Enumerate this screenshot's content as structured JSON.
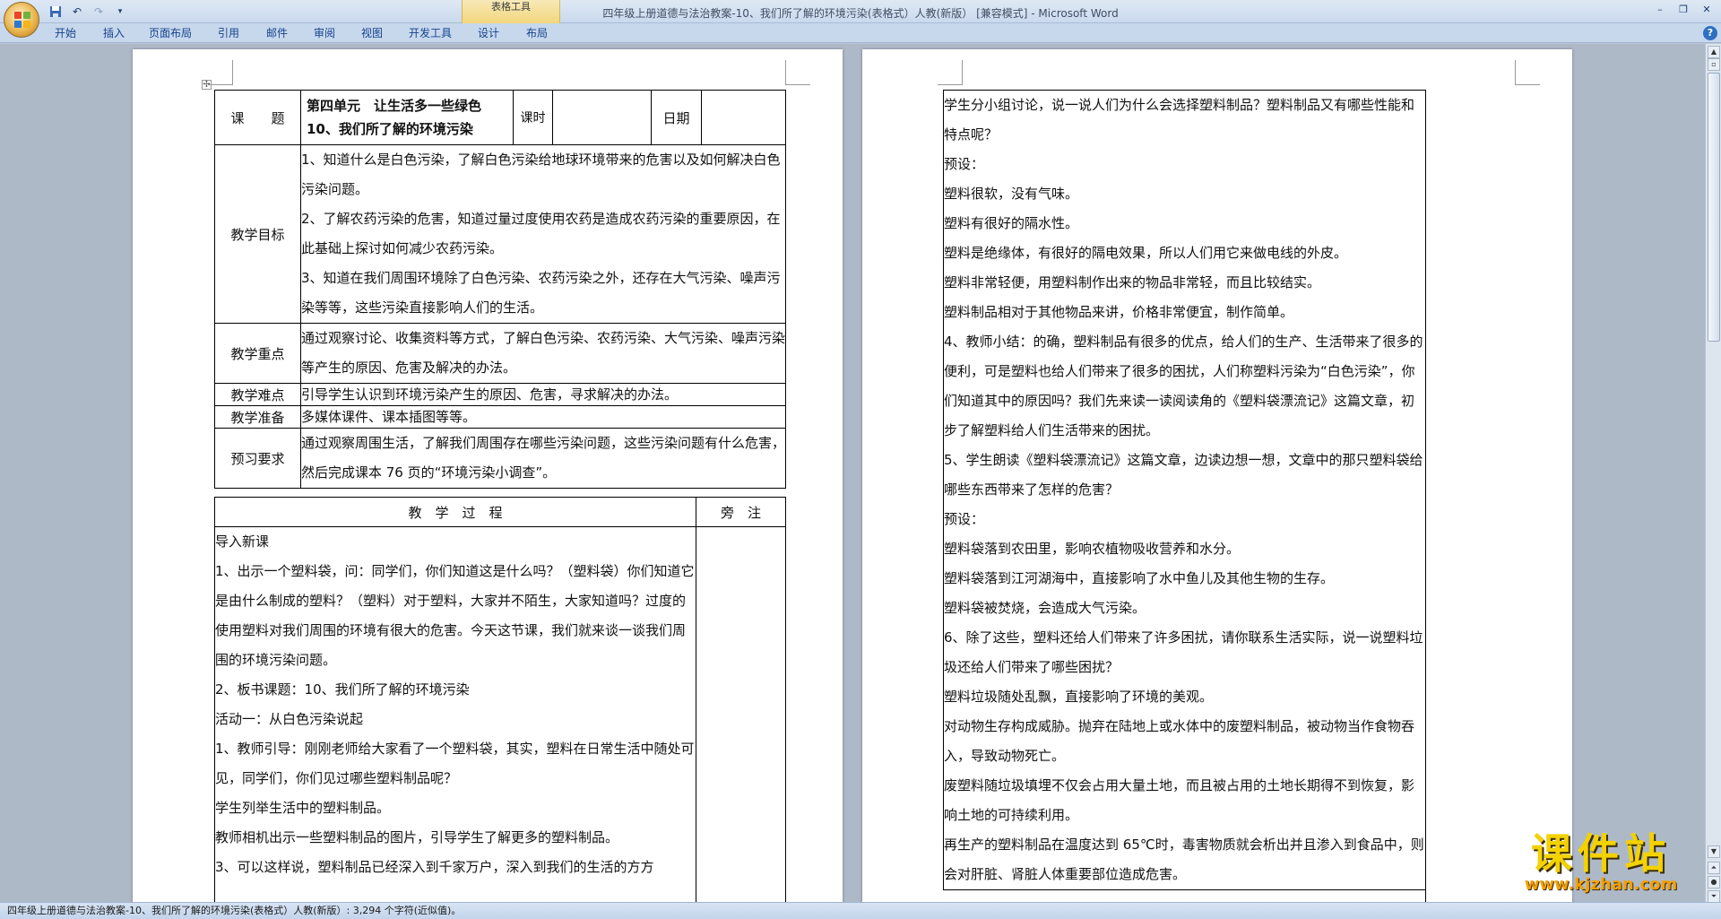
{
  "app": {
    "title": "四年级上册道德与法治教案-10、我们所了解的环境污染(表格式）人教(新版）  [兼容模式] - Microsoft Word",
    "table_tools_label": "表格工具",
    "tabs": [
      "开始",
      "插入",
      "页面布局",
      "引用",
      "邮件",
      "审阅",
      "视图",
      "开发工具",
      "设计",
      "布局"
    ],
    "qat": {
      "save": "save-icon",
      "undo": "undo-icon",
      "redo": "redo-icon",
      "customize": "▾"
    },
    "window_controls": {
      "minimize": "–",
      "restore": "❐",
      "close": "✕"
    },
    "help": "?"
  },
  "status": {
    "text": "四年级上册道德与法治教案-10、我们所了解的环境污染(表格式）人教(新版）: 3,294 个字符(近似值)。"
  },
  "page1": {
    "r1": {
      "label": "课　　题",
      "unit": "第四单元　让生活多一些绿色",
      "lesson": "10、我们所了解的环境污染",
      "period_label": "课时",
      "period_value": "",
      "date_label": "日期",
      "date_value": ""
    },
    "goals": {
      "label": "教学目标",
      "items": [
        "1、知道什么是白色污染，了解白色污染给地球环境带来的危害以及如何解决白色污染问题。",
        "2、了解农药污染的危害，知道过量过度使用农药是造成农药污染的重要原因，在此基础上探讨如何减少农药污染。",
        "3、知道在我们周围环境除了白色污染、农药污染之外，还存在大气污染、噪声污染等等，这些污染直接影响人们的生活。"
      ]
    },
    "key": {
      "label": "教学重点",
      "text": "通过观察讨论、收集资料等方式，了解白色污染、农药污染、大气污染、噪声污染等产生的原因、危害及解决的办法。"
    },
    "difficulty": {
      "label": "教学难点",
      "text": "引导学生认识到环境污染产生的原因、危害，寻求解决的办法。"
    },
    "prep": {
      "label": "教学准备",
      "text": "多媒体课件、课本插图等等。"
    },
    "preview": {
      "label": "预习要求",
      "text": "通过观察周围生活，了解我们周围存在哪些污染问题，这些污染问题有什么危害，然后完成课本 76 页的“环境污染小调查”。"
    },
    "process_header": "教　学　过　程",
    "side_header": "旁　注",
    "process": [
      "导入新课",
      "1、出示一个塑料袋，问：同学们，你们知道这是什么吗？（塑料袋）你们知道它是由什么制成的塑料？（塑料）对于塑料，大家并不陌生，大家知道吗？过度的使用塑料对我们周围的环境有很大的危害。今天这节课，我们就来谈一谈我们周围的环境污染问题。",
      "2、板书课题：10、我们所了解的环境污染",
      "活动一：从白色污染说起",
      "1、教师引导：刚刚老师给大家看了一个塑料袋，其实，塑料在日常生活中随处可见，同学们，你们见过哪些塑料制品呢？",
      "学生列举生活中的塑料制品。",
      "教师相机出示一些塑料制品的图片，引导学生了解更多的塑料制品。",
      "3、可以这样说，塑料制品已经深入到千家万户，深入到我们的生活的方方"
    ]
  },
  "page2": {
    "paragraphs": [
      "学生分小组讨论，说一说人们为什么会选择塑料制品？塑料制品又有哪些性能和特点呢？",
      "预设：",
      "塑料很软，没有气味。",
      "塑料有很好的隔水性。",
      "塑料是绝缘体，有很好的隔电效果，所以人们用它来做电线的外皮。",
      "塑料非常轻便，用塑料制作出来的物品非常轻，而且比较结实。",
      "塑料制品相对于其他物品来讲，价格非常便宜，制作简单。",
      "4、教师小结：的确，塑料制品有很多的优点，给人们的生产、生活带来了很多的便利，可是塑料也给人们带来了很多的困扰，人们称塑料污染为“白色污染”，你们知道其中的原因吗？我们先来读一读阅读角的《塑料袋漂流记》这篇文章，初步了解塑料给人们生活带来的困扰。",
      "5、学生朗读《塑料袋漂流记》这篇文章，边读边想一想，文章中的那只塑料袋给哪些东西带来了怎样的危害？",
      "预设：",
      "塑料袋落到农田里，影响农植物吸收营养和水分。",
      "塑料袋落到江河湖海中，直接影响了水中鱼儿及其他生物的生存。",
      "塑料袋被焚烧，会造成大气污染。",
      "6、除了这些，塑料还给人们带来了许多困扰，请你联系生活实际，说一说塑料垃圾还给人们带来了哪些困扰？",
      "塑料垃圾随处乱飘，直接影响了环境的美观。",
      "对动物生存构成威胁。抛弃在陆地上或水体中的废塑料制品，被动物当作食物吞入，导致动物死亡。",
      "废塑料随垃圾填埋不仅会占用大量土地，而且被占用的土地长期得不到恢复，影响土地的可持续利用。",
      "再生产的塑料制品在温度达到 65℃时，毒害物质就会析出并且渗入到食品中，则会对肝脏、肾脏人体重要部位造成危害。"
    ]
  },
  "watermark": {
    "title": "课件站",
    "url": "www.kjzhan.com"
  },
  "colors": {
    "accent": "#15428b",
    "watermark": "#f3d200",
    "ribbon": "#c7d8ed"
  }
}
